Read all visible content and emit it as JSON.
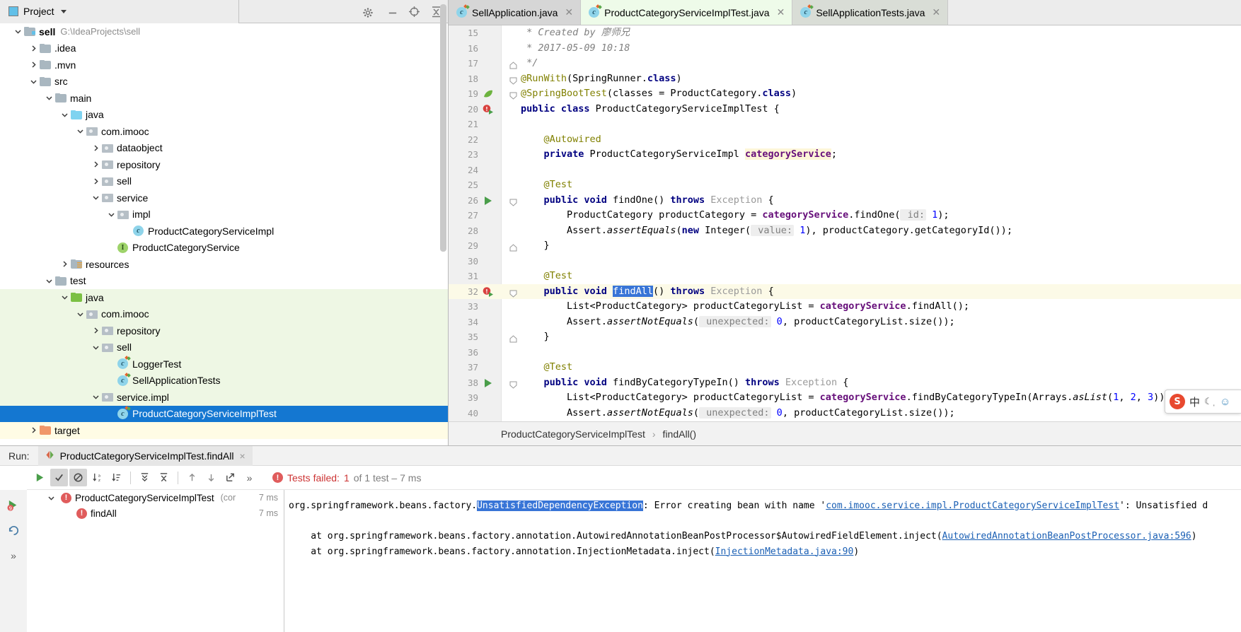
{
  "project_panel": {
    "title": "Project",
    "icons": [
      "target-locate-icon",
      "collapse-all-icon"
    ],
    "tree": [
      {
        "label": "sell",
        "path": "G:\\IdeaProjects\\sell",
        "depth": 0,
        "icon": "module-folder-icon",
        "twist": "down",
        "bold": true,
        "bg": "white"
      },
      {
        "label": ".idea",
        "path": "",
        "depth": 1,
        "icon": "folder-grey-icon",
        "twist": "right",
        "bold": false,
        "bg": "white"
      },
      {
        "label": ".mvn",
        "path": "",
        "depth": 1,
        "icon": "folder-grey-icon",
        "twist": "right",
        "bold": false,
        "bg": "white"
      },
      {
        "label": "src",
        "path": "",
        "depth": 1,
        "icon": "folder-grey-icon",
        "twist": "down",
        "bold": false,
        "bg": "white"
      },
      {
        "label": "main",
        "path": "",
        "depth": 2,
        "icon": "folder-grey-icon",
        "twist": "down",
        "bold": false,
        "bg": "white"
      },
      {
        "label": "java",
        "path": "",
        "depth": 3,
        "icon": "folder-blue-icon",
        "twist": "down",
        "bold": false,
        "bg": "white"
      },
      {
        "label": "com.imooc",
        "path": "",
        "depth": 4,
        "icon": "package-icon",
        "twist": "down",
        "bold": false,
        "bg": "white"
      },
      {
        "label": "dataobject",
        "path": "",
        "depth": 5,
        "icon": "package-icon",
        "twist": "right",
        "bold": false,
        "bg": "white"
      },
      {
        "label": "repository",
        "path": "",
        "depth": 5,
        "icon": "package-icon",
        "twist": "right",
        "bold": false,
        "bg": "white"
      },
      {
        "label": "sell",
        "path": "",
        "depth": 5,
        "icon": "package-icon",
        "twist": "right",
        "bold": false,
        "bg": "white"
      },
      {
        "label": "service",
        "path": "",
        "depth": 5,
        "icon": "package-icon",
        "twist": "down",
        "bold": false,
        "bg": "white"
      },
      {
        "label": "impl",
        "path": "",
        "depth": 6,
        "icon": "package-icon",
        "twist": "down",
        "bold": false,
        "bg": "white"
      },
      {
        "label": "ProductCategoryServiceImpl",
        "path": "",
        "depth": 7,
        "icon": "class-icon",
        "twist": "none",
        "bold": false,
        "bg": "white"
      },
      {
        "label": "ProductCategoryService",
        "path": "",
        "depth": 6,
        "icon": "interface-icon",
        "twist": "none",
        "bold": false,
        "bg": "white"
      },
      {
        "label": "resources",
        "path": "",
        "depth": 3,
        "icon": "resources-folder-icon",
        "twist": "right",
        "bold": false,
        "bg": "white"
      },
      {
        "label": "test",
        "path": "",
        "depth": 2,
        "icon": "folder-grey-icon",
        "twist": "down",
        "bold": false,
        "bg": "white"
      },
      {
        "label": "java",
        "path": "",
        "depth": 3,
        "icon": "folder-green-icon",
        "twist": "down",
        "bold": false,
        "bg": "green"
      },
      {
        "label": "com.imooc",
        "path": "",
        "depth": 4,
        "icon": "package-icon",
        "twist": "down",
        "bold": false,
        "bg": "green"
      },
      {
        "label": "repository",
        "path": "",
        "depth": 5,
        "icon": "package-icon",
        "twist": "right",
        "bold": false,
        "bg": "green"
      },
      {
        "label": "sell",
        "path": "",
        "depth": 5,
        "icon": "package-icon",
        "twist": "down",
        "bold": false,
        "bg": "green"
      },
      {
        "label": "LoggerTest",
        "path": "",
        "depth": 6,
        "icon": "test-class-icon",
        "twist": "none",
        "bold": false,
        "bg": "green"
      },
      {
        "label": "SellApplicationTests",
        "path": "",
        "depth": 6,
        "icon": "test-class-icon",
        "twist": "none",
        "bold": false,
        "bg": "green"
      },
      {
        "label": "service.impl",
        "path": "",
        "depth": 5,
        "icon": "package-icon",
        "twist": "down",
        "bold": false,
        "bg": "green"
      },
      {
        "label": "ProductCategoryServiceImplTest",
        "path": "",
        "depth": 6,
        "icon": "test-class-icon",
        "twist": "none",
        "bold": false,
        "bg": "selected"
      },
      {
        "label": "target",
        "path": "",
        "depth": 1,
        "icon": "folder-orange-icon",
        "twist": "right",
        "bold": false,
        "bg": "yellow"
      }
    ]
  },
  "editor": {
    "tabs": [
      {
        "label": "SellApplication.java",
        "icon": "java-class-icon",
        "state": "inactive"
      },
      {
        "label": "ProductCategoryServiceImplTest.java",
        "icon": "java-class-icon",
        "state": "active"
      },
      {
        "label": "SellApplicationTests.java",
        "icon": "java-class-icon",
        "state": "inactive"
      }
    ],
    "tools": [
      "gear-icon",
      "minimize-icon"
    ],
    "lines": [
      {
        "n": "15",
        "gutter": "",
        "fold": "",
        "hl": false
      },
      {
        "n": "16",
        "gutter": "",
        "fold": "",
        "hl": false
      },
      {
        "n": "17",
        "gutter": "",
        "fold": "fold-end",
        "hl": false
      },
      {
        "n": "18",
        "gutter": "",
        "fold": "fold-start",
        "hl": false
      },
      {
        "n": "19",
        "gutter": "spring-leaf-icon",
        "fold": "fold-start",
        "hl": false
      },
      {
        "n": "20",
        "gutter": "run-fail-icon",
        "fold": "",
        "hl": false
      },
      {
        "n": "21",
        "gutter": "",
        "fold": "",
        "hl": false
      },
      {
        "n": "22",
        "gutter": "",
        "fold": "",
        "hl": false
      },
      {
        "n": "23",
        "gutter": "",
        "fold": "",
        "hl": false
      },
      {
        "n": "24",
        "gutter": "",
        "fold": "",
        "hl": false
      },
      {
        "n": "25",
        "gutter": "",
        "fold": "",
        "hl": false
      },
      {
        "n": "26",
        "gutter": "run-icon",
        "fold": "fold-start",
        "hl": false
      },
      {
        "n": "27",
        "gutter": "",
        "fold": "",
        "hl": false
      },
      {
        "n": "28",
        "gutter": "",
        "fold": "",
        "hl": false
      },
      {
        "n": "29",
        "gutter": "",
        "fold": "fold-end",
        "hl": false
      },
      {
        "n": "30",
        "gutter": "",
        "fold": "",
        "hl": false
      },
      {
        "n": "31",
        "gutter": "",
        "fold": "",
        "hl": false
      },
      {
        "n": "32",
        "gutter": "run-fail-icon",
        "fold": "fold-start",
        "hl": true
      },
      {
        "n": "33",
        "gutter": "",
        "fold": "",
        "hl": false
      },
      {
        "n": "34",
        "gutter": "",
        "fold": "",
        "hl": false
      },
      {
        "n": "35",
        "gutter": "",
        "fold": "fold-end",
        "hl": false
      },
      {
        "n": "36",
        "gutter": "",
        "fold": "",
        "hl": false
      },
      {
        "n": "37",
        "gutter": "",
        "fold": "",
        "hl": false
      },
      {
        "n": "38",
        "gutter": "run-icon",
        "fold": "fold-start",
        "hl": false
      },
      {
        "n": "39",
        "gutter": "",
        "fold": "",
        "hl": false
      },
      {
        "n": "40",
        "gutter": "",
        "fold": "",
        "hl": false
      }
    ],
    "code_text": [
      " * Created by 廖师兄",
      " * 2017-05-09 10:18",
      " */",
      "@RunWith(SpringRunner.class)",
      "@SpringBootTest(classes = ProductCategory.class)",
      "public class ProductCategoryServiceImplTest {",
      "",
      "    @Autowired",
      "    private ProductCategoryServiceImpl categoryService;",
      "",
      "    @Test",
      "    public void findOne() throws Exception {",
      "        ProductCategory productCategory = categoryService.findOne( id: 1);",
      "        Assert.assertEquals(new Integer( value: 1), productCategory.getCategoryId());",
      "    }",
      "",
      "    @Test",
      "    public void findAll() throws Exception {",
      "        List<ProductCategory> productCategoryList = categoryService.findAll();",
      "        Assert.assertNotEquals( unexpected: 0, productCategoryList.size());",
      "    }",
      "",
      "    @Test",
      "    public void findByCategoryTypeIn() throws Exception {",
      "        List<ProductCategory> productCategoryList = categoryService.findByCategoryTypeIn(Arrays.asList(1, 2, 3));",
      "        Assert.assertNotEquals( unexpected: 0, productCategoryList.size());"
    ],
    "selected_text": "findAll",
    "highlighted_field": "categoryService",
    "breadcrumb": {
      "class": "ProductCategoryServiceImplTest",
      "separator": "›",
      "method": "findAll()"
    }
  },
  "ime": {
    "logo": "S",
    "language": "中",
    "moon": "☾ˌ",
    "smile": "☺"
  },
  "run_panel": {
    "run_label": "Run:",
    "tab_label": "ProductCategoryServiceImplTest.findAll",
    "tab_close": "×",
    "toolbar_icons": [
      "rerun-icon",
      "show-passed-icon",
      "hide-ignored-icon",
      "sort-alphabetically-icon",
      "sort-by-duration-icon",
      "expand-all-icon",
      "collapse-all-icon",
      "prev-failed-icon",
      "next-failed-icon",
      "export-icon",
      "more-icon"
    ],
    "status": {
      "failed_label": "Tests failed:",
      "failed_count": "1",
      "detail": "of 1 test – 7 ms"
    },
    "tree": [
      {
        "label": "ProductCategoryServiceImplTest",
        "suffix": "(cor",
        "time": "7 ms",
        "depth": 0,
        "icon": "error-icon",
        "twist": "down"
      },
      {
        "label": "findAll",
        "suffix": "",
        "time": "7 ms",
        "depth": 1,
        "icon": "error-icon",
        "twist": "none"
      }
    ],
    "left_icons": [
      "rerun-failed-icon",
      "rotate-icon",
      "more-icon"
    ],
    "console": [
      {
        "parts": [
          {
            "t": "org.springframework.beans.factory.",
            "s": "plain"
          },
          {
            "t": "UnsatisfiedDependencyException",
            "s": "selected"
          },
          {
            "t": ": Error creating bean with name '",
            "s": "plain"
          },
          {
            "t": "com.imooc.service.impl.ProductCategoryServiceImplTest",
            "s": "link"
          },
          {
            "t": "': Unsatisfied d",
            "s": "plain"
          }
        ]
      },
      {
        "parts": []
      },
      {
        "parts": [
          {
            "t": "    at org.springframework.beans.factory.annotation.AutowiredAnnotationBeanPostProcessor$AutowiredFieldElement.inject(",
            "s": "plain"
          },
          {
            "t": "AutowiredAnnotationBeanPostProcessor.java:596",
            "s": "link"
          },
          {
            "t": ")",
            "s": "plain"
          }
        ]
      },
      {
        "parts": [
          {
            "t": "    at org.springframework.beans.factory.annotation.InjectionMetadata.inject(",
            "s": "plain"
          },
          {
            "t": "InjectionMetadata.java:90",
            "s": "link"
          },
          {
            "t": ")",
            "s": "plain"
          }
        ]
      }
    ]
  },
  "colors": {
    "selection_blue": "#1477d1",
    "test_green": "#eef7e4",
    "target_yellow": "#fffce5",
    "error_red": "#cc3333",
    "link_blue": "#1a5fb4"
  }
}
